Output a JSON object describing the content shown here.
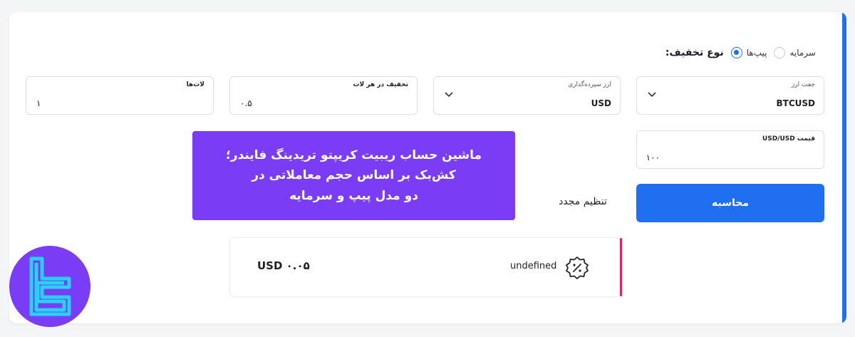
{
  "rebate_type": {
    "title": "نوع تخفیف:",
    "options": [
      {
        "label": "پیپ‌ها",
        "selected": true
      },
      {
        "label": "سرمایه",
        "selected": false
      }
    ]
  },
  "fields": {
    "currency_pair": {
      "label": "جفت ارز",
      "value": "BTCUSD"
    },
    "deposit_currency": {
      "label": "ارز سپرده‌گذاری",
      "value": "USD"
    },
    "discount_per_lot": {
      "label": "تخفیف در هر لات",
      "value": "۰.۵"
    },
    "lots": {
      "label": "لات‌ها",
      "value": "۱"
    },
    "price": {
      "label": "قیمت USD/USD",
      "value": "۱۰۰"
    }
  },
  "buttons": {
    "calculate": "محاسبه",
    "reset": "تنظیم مجدد"
  },
  "banner": {
    "lines": [
      "ماشین حساب ریبیت کریپتو تریدینگ فایندر؛",
      "کش‌بک بر اساس حجم معاملاتی در",
      "دو مدل پیپ و سرمایه"
    ]
  },
  "result": {
    "label": "undefined",
    "amount": "USD ۰.۰۵"
  },
  "colors": {
    "accent": "#1f6ff0",
    "banner": "#7a3cf5",
    "result_accent": "#e0245e",
    "logo_glyph": "#27d3f5"
  }
}
